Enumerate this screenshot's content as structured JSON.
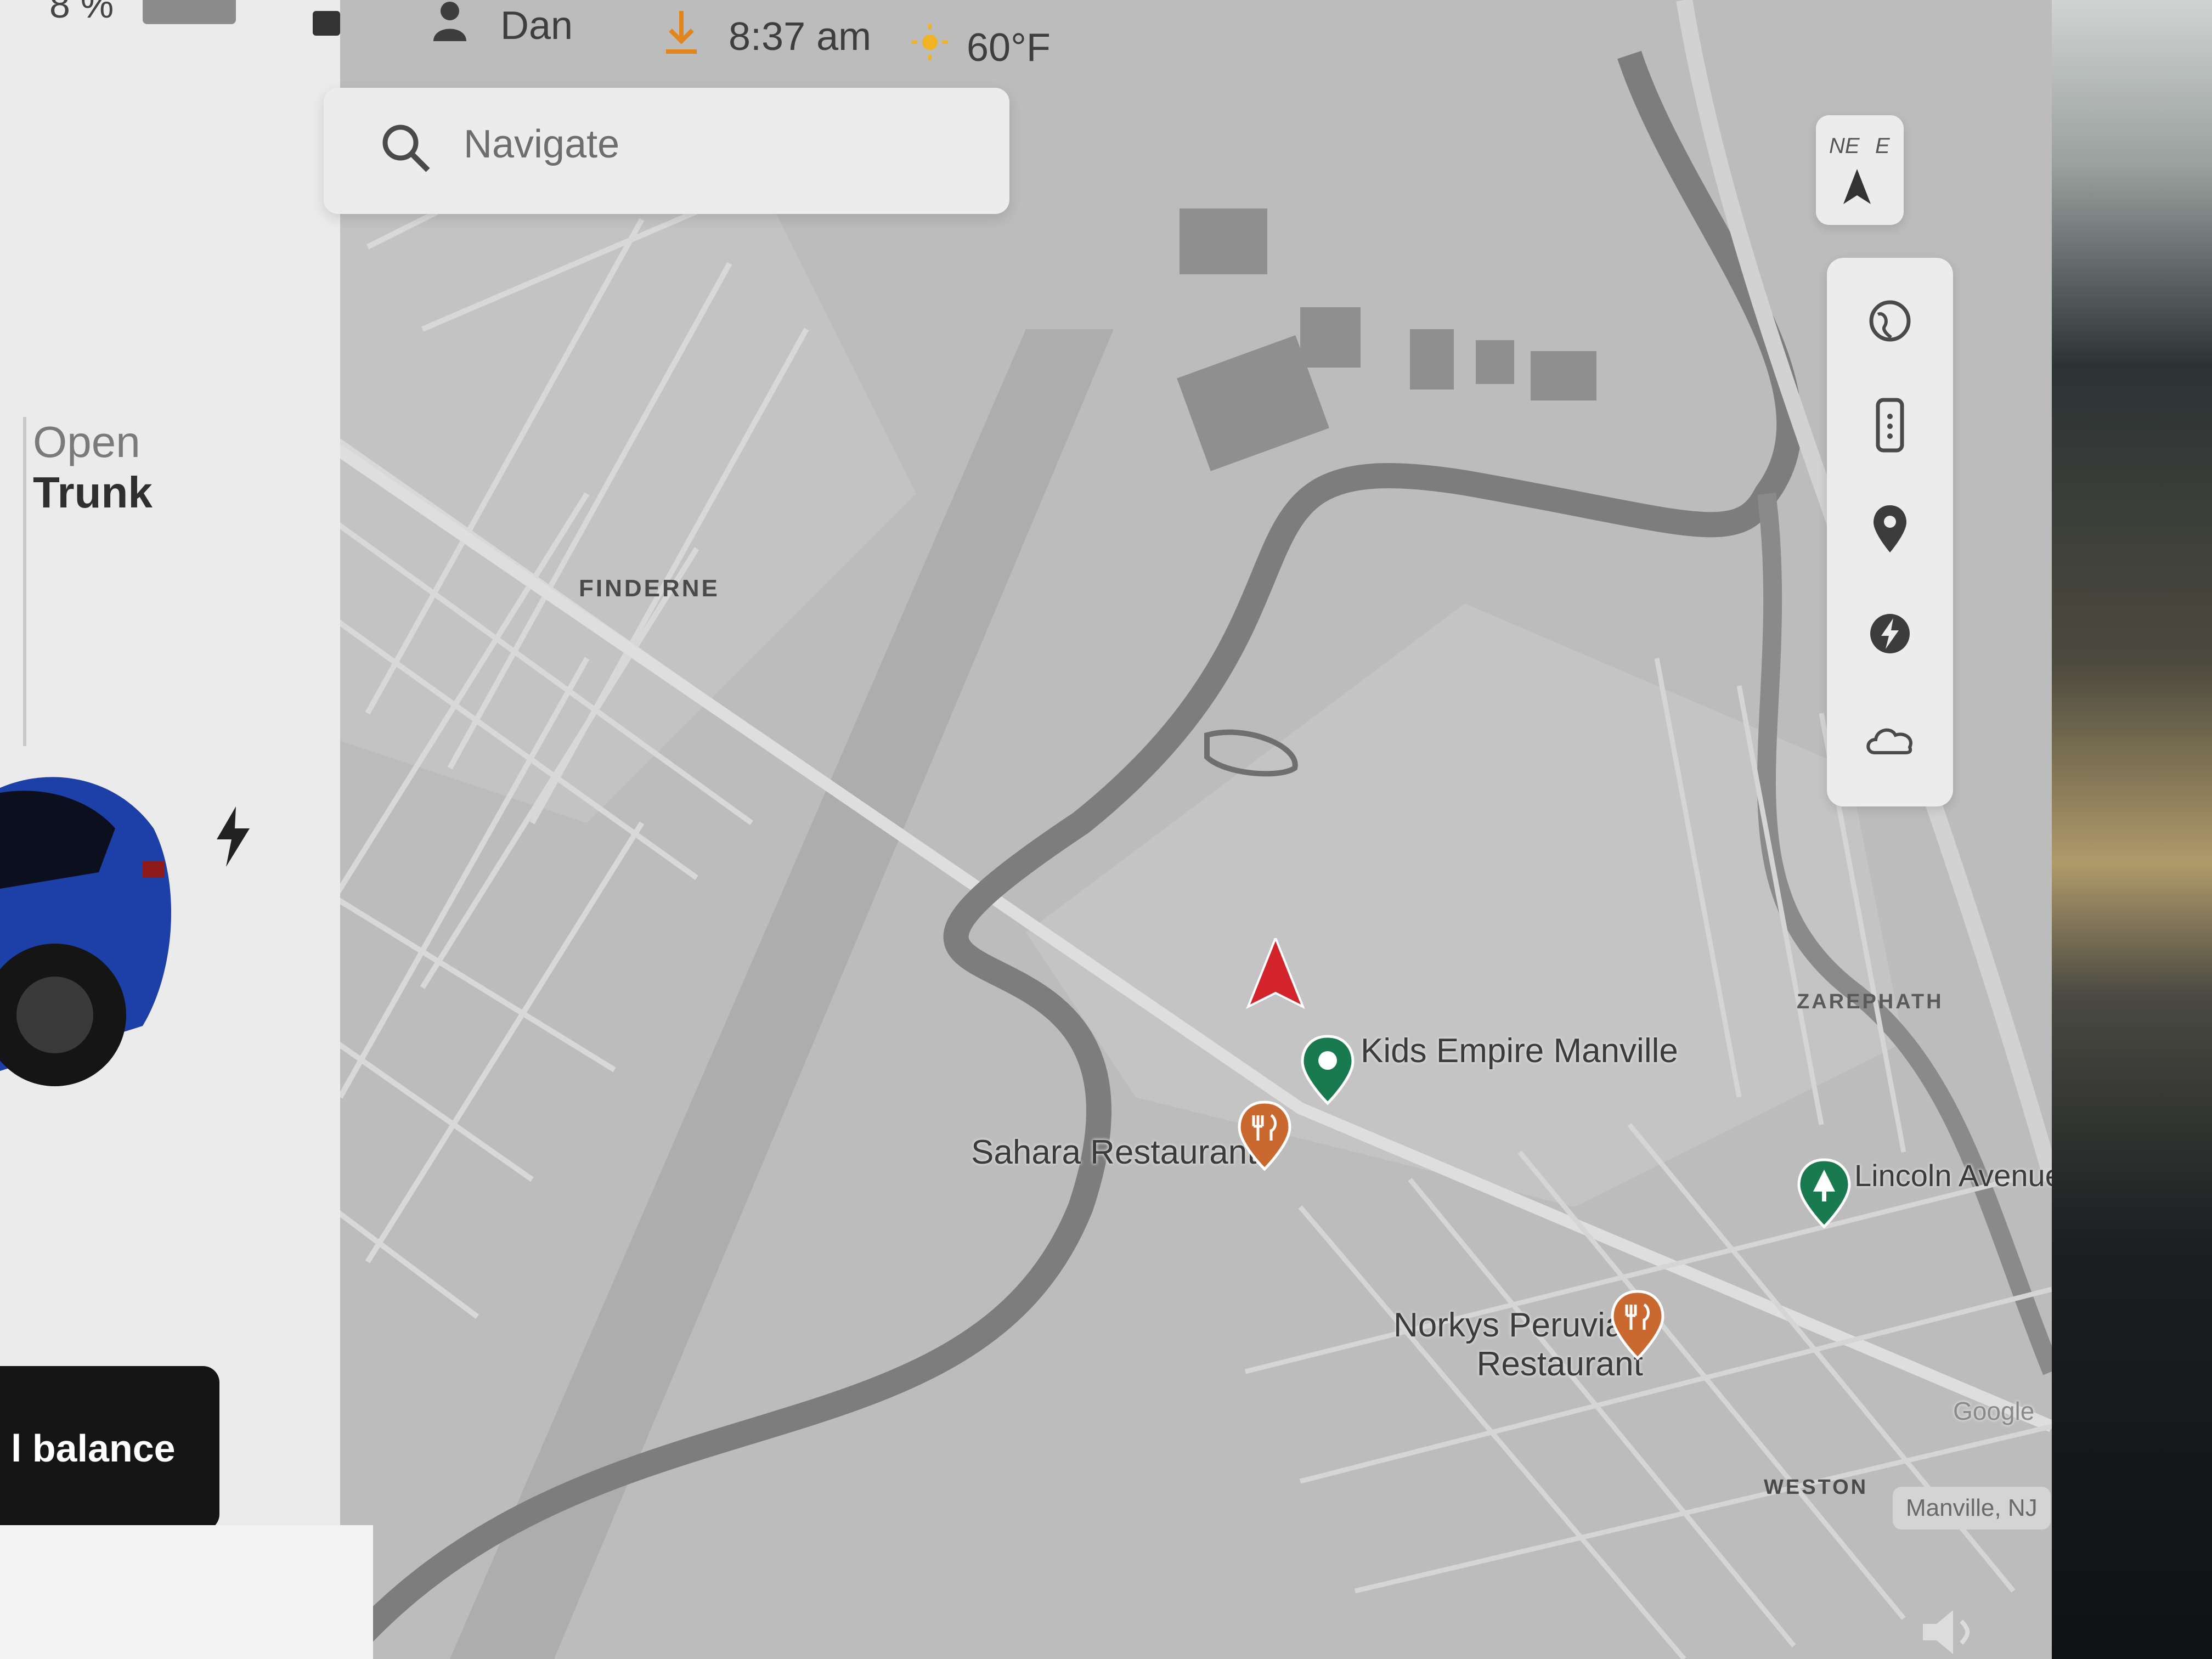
{
  "status_bar": {
    "battery": "8 %",
    "user": "Dan",
    "time": "8:37 am",
    "temperature": "60°F"
  },
  "vehicle_panel": {
    "trunk_line1": "Open",
    "trunk_line2": "Trunk",
    "balance_label": "l balance"
  },
  "search": {
    "placeholder": "Navigate"
  },
  "compass": {
    "dir1": "NE",
    "dir2": "E"
  },
  "map": {
    "areas": {
      "finderne": "FINDERNE",
      "zarephath": "ZAREPHATH",
      "weston": "WESTON"
    },
    "places": {
      "kids_empire": "Kids Empire Manville",
      "sahara": "Sahara Restaurant",
      "norkys_line1": "Norkys Peruvian",
      "norkys_line2": "Restaurant",
      "lincoln": "Lincoln Avenue"
    },
    "attribution": "Google",
    "location_badge": "Manville, NJ"
  },
  "controls": [
    "globe-icon",
    "phone-icon",
    "pin-icon",
    "charging-icon",
    "weather-icon"
  ],
  "colors": {
    "nav_arrow": "#d3232b",
    "restaurant_pin": "#c9682f",
    "place_pin": "#1a7a4f",
    "map_bg": "#bdbdbd",
    "road": "#d9d9d9",
    "river": "#7a7a7a"
  }
}
